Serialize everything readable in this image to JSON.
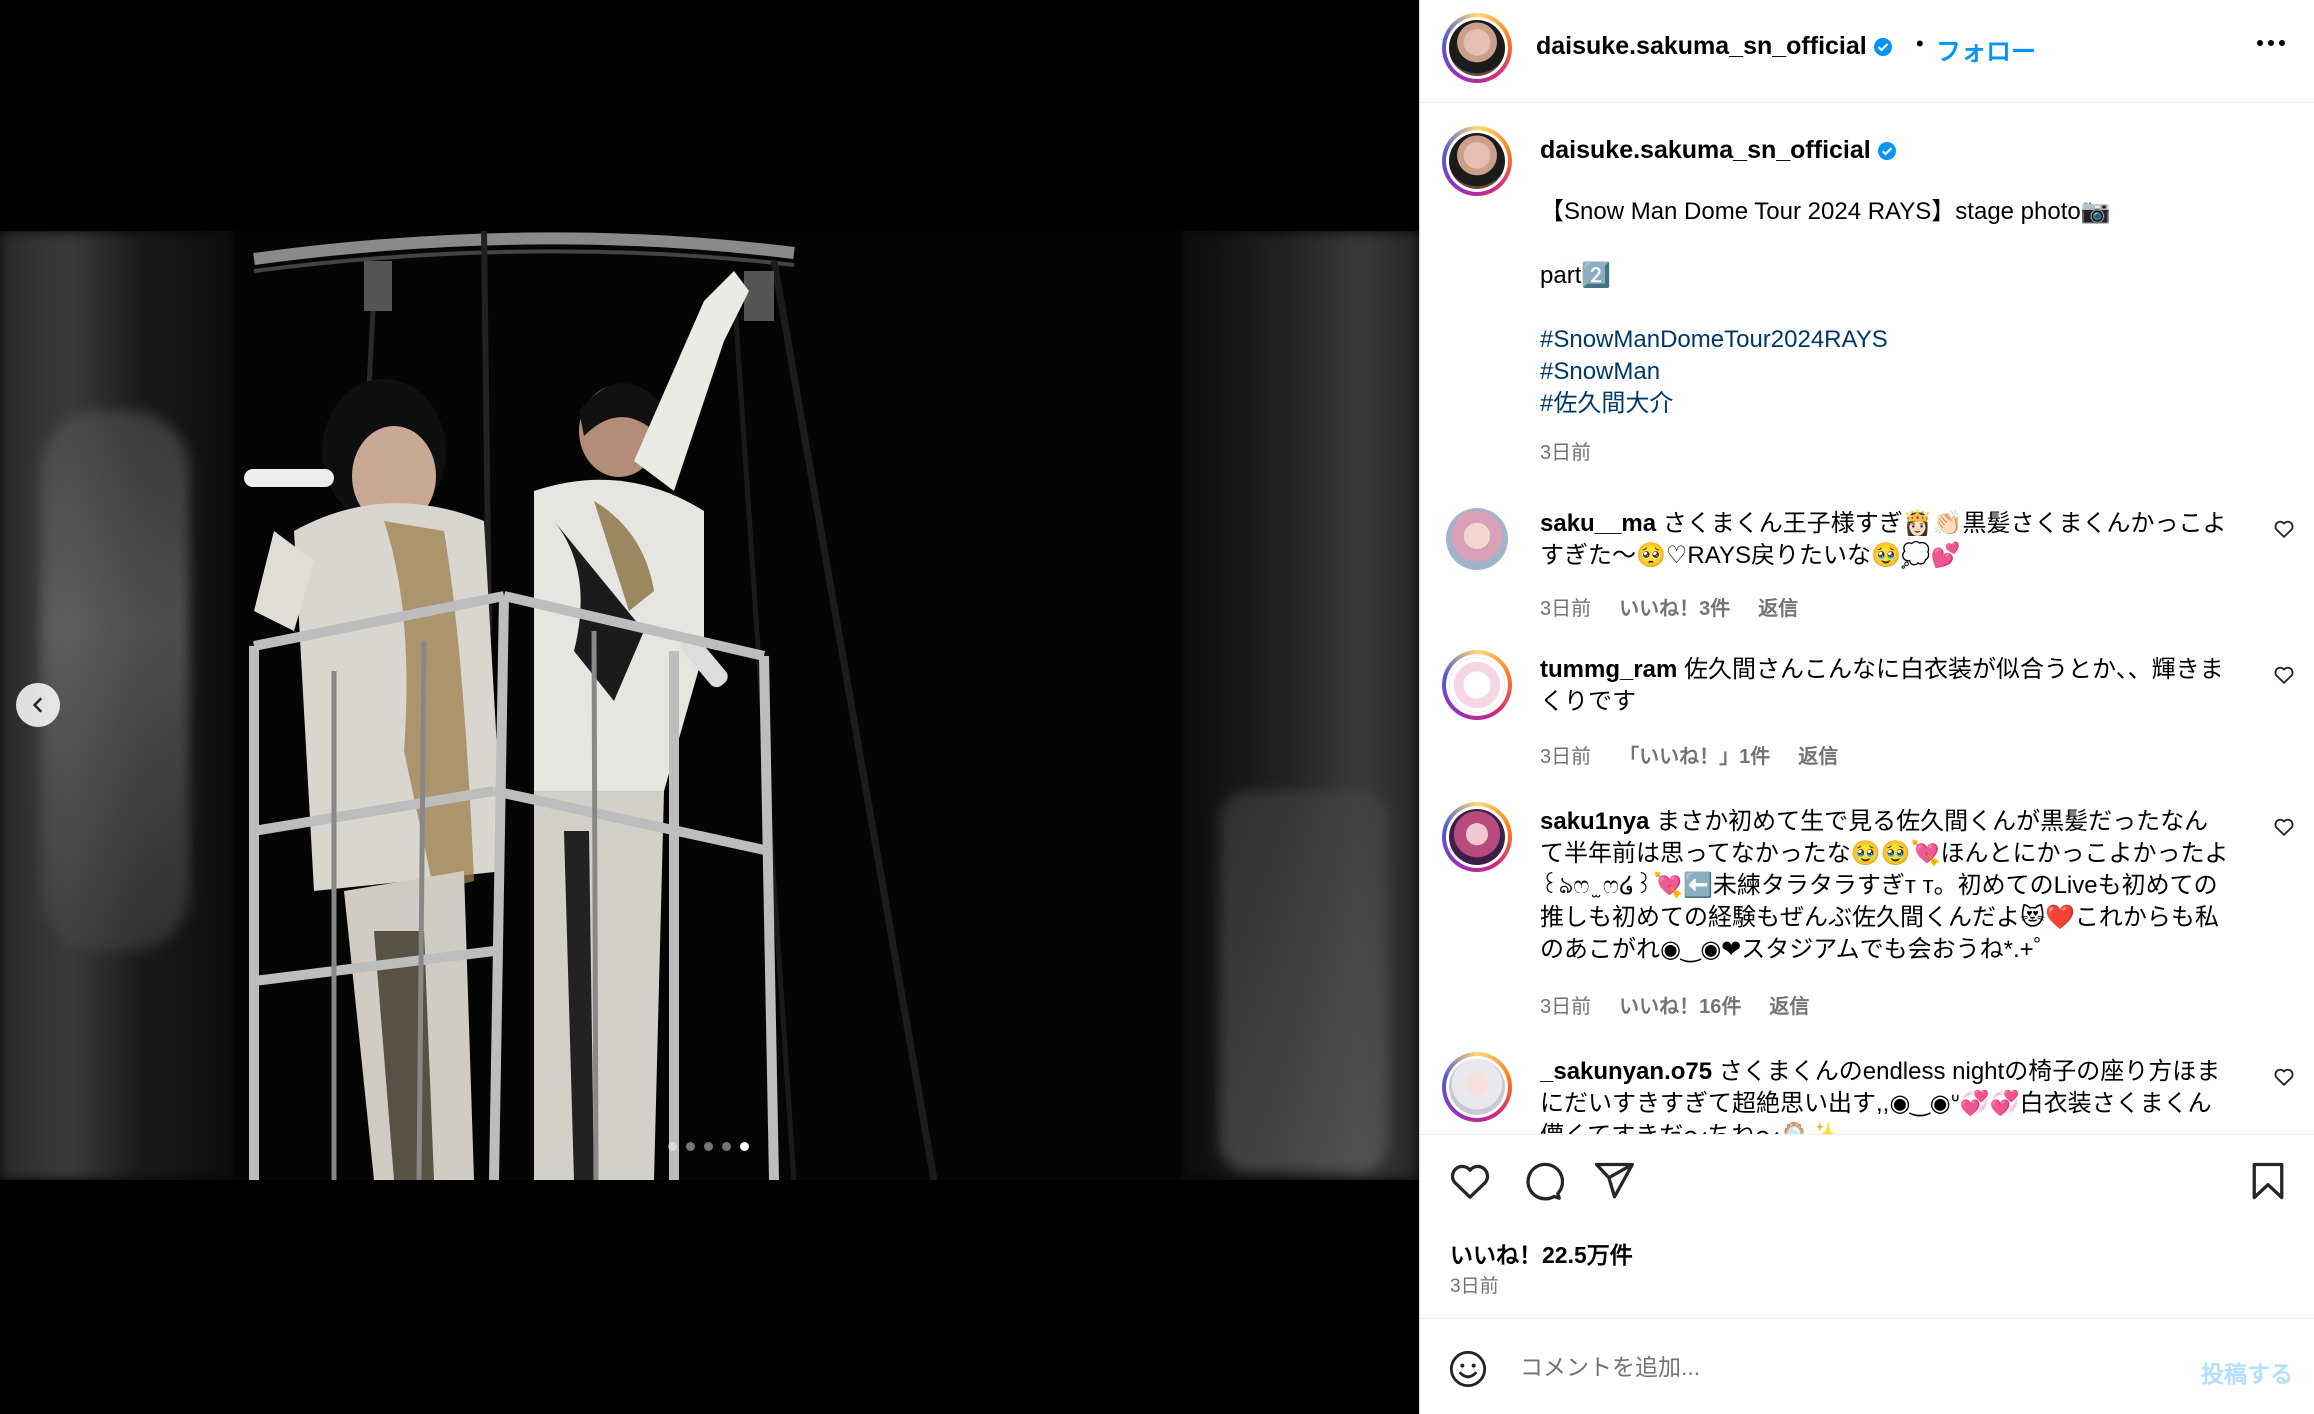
{
  "post": {
    "username": "daisuke.sakuma_sn_official",
    "follow_label": "フォロー",
    "separator": "•",
    "caption_lines": [
      "【Snow Man Dome Tour 2024 RAYS】stage photo📷",
      "",
      "part2️⃣",
      ""
    ],
    "hashtags": [
      "#SnowManDomeTour2024RAYS",
      "#SnowMan",
      "#佐久間大介"
    ],
    "caption_time": "3日前",
    "likes": "いいね！22.5万件",
    "time": "3日前"
  },
  "carousel": {
    "slide_count": 5,
    "active_index": 4
  },
  "comments": [
    {
      "user": "saku__ma",
      "text": "さくまくん王子様すぎ👸🏻👏🏻黒髪さくまくんかっこよすぎた〜🥺♡RAYS戻りたいな🥹💭💕",
      "time": "3日前",
      "likes": "いいね！3件",
      "reply": "返信"
    },
    {
      "user": "tummg_ram",
      "text": "佐久間さんこんなに白衣装が似合うとか、、輝きまくりです",
      "time": "3日前",
      "likes": "「いいね！」1件",
      "reply": "返信"
    },
    {
      "user": "saku1nya",
      "text": "まさか初めて生で見る佐久間くんが黒髪だったなんて半年前は思ってなかったな🥹🥹💘ほんとにかっこよかったよ꒰ঌෆ ̫ ෆ໒꒱💘⬅️未練タラタラすぎт т。初めてのLiveも初めての推しも初めての経験もぜんぶ佐久間くんだよ😻❤️これからも私のあこがれ◉‿◉❤スタジアムでも会おうね*.+゜",
      "time": "3日前",
      "likes": "いいね！16件",
      "reply": "返信"
    },
    {
      "user": "_sakunyan.o75",
      "text": "さくまくんのendless nightの椅子の座り方ほまにだいすきすぎて超絶思い出す,,◉‿◉ᐡ💞💞白衣装さくまくん儚くてすきだ〜ちね〜🪞✨",
      "time": "",
      "likes": "",
      "reply": ""
    }
  ],
  "composer": {
    "placeholder": "コメントを追加...",
    "post_label": "投稿する"
  },
  "colors": {
    "link": "#0095f6",
    "hashtag": "#00376b",
    "muted": "#737373",
    "verified": "#0095f6"
  },
  "icons": [
    "chevron-left-icon",
    "more-icon",
    "verified-icon",
    "heart-icon",
    "comment-icon",
    "share-icon",
    "bookmark-icon",
    "emoji-icon"
  ]
}
